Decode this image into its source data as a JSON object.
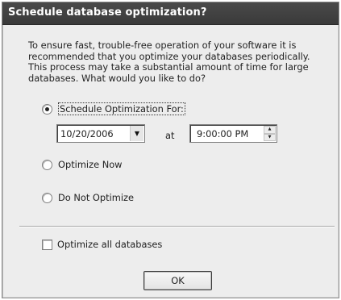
{
  "dialog": {
    "title": "Schedule database optimization?",
    "description": "To ensure fast, trouble-free operation of your software it is recommended that you optimize your databases periodically. This process may take a substantial amount of time for large databases. What would you like to do?"
  },
  "options": {
    "schedule_label": "Schedule Optimization For:",
    "date_value": "10/20/2006",
    "at_label": "at",
    "time_value": "9:00:00 PM",
    "optimize_now_label": "Optimize Now",
    "do_not_optimize_label": "Do Not Optimize",
    "selected": "schedule"
  },
  "footer": {
    "checkbox_label": "Optimize all databases",
    "checkbox_checked": false,
    "ok_label": "OK"
  },
  "icons": {
    "dropdown": "chevron-down-icon",
    "spin_up": "spin-up-icon",
    "spin_down": "spin-down-icon"
  }
}
